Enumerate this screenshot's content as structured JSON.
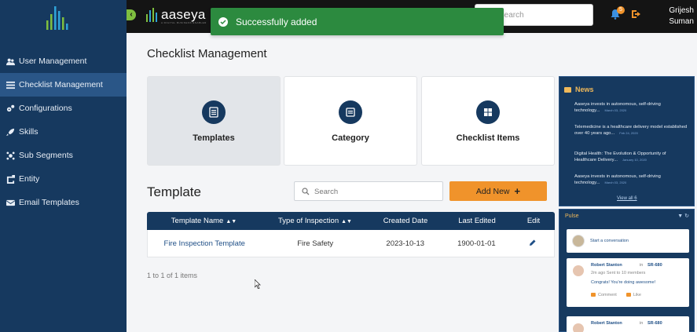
{
  "sidebar": {
    "items": [
      {
        "label": "User Management",
        "icon": "users-icon"
      },
      {
        "label": "Checklist Management",
        "icon": "list-icon",
        "active": true
      },
      {
        "label": "Configurations",
        "icon": "gears-icon"
      },
      {
        "label": "Skills",
        "icon": "rocket-icon"
      },
      {
        "label": "Sub Segments",
        "icon": "sitemap-icon"
      },
      {
        "label": "Entity",
        "icon": "entity-icon"
      },
      {
        "label": "Email Templates",
        "icon": "envelope-icon"
      }
    ]
  },
  "header": {
    "brand": "aaseya",
    "brand_tagline": "A DIGITAL BUSINESS ENABLER",
    "search_placeholder": "Search",
    "notification_count": "5",
    "user_first": "Grijesh",
    "user_last": "Suman"
  },
  "toast": {
    "message": "Successfully added"
  },
  "main": {
    "title": "Checklist Management",
    "cards": [
      {
        "label": "Templates",
        "selected": true
      },
      {
        "label": "Category"
      },
      {
        "label": "Checklist Items"
      }
    ],
    "section_title": "Template",
    "search_placeholder": "Search",
    "add_button": "Add New",
    "table": {
      "columns": [
        "Template Name",
        "Type of Inspection",
        "Created Date",
        "Last Edited",
        "Edit"
      ],
      "rows": [
        {
          "name": "Fire Inspection Template",
          "type": "Fire Safety",
          "created": "2023-10-13",
          "edited": "1900-01-01"
        }
      ]
    },
    "pager": "1 to 1 of 1 items"
  },
  "news": {
    "title": "News",
    "items": [
      {
        "text": "Aaseya invests in autonomous, self-driving technology...",
        "date": "March 03, 2020"
      },
      {
        "text": "Telemedicine is a healthcare delivery model established over 40 years ago...",
        "date": "Feb 24, 2020"
      },
      {
        "text": "Digital Health: The Evolution & Opportunity of Healthcare Delivery...",
        "date": "January 10, 2020"
      },
      {
        "text": "Aaseya invests in autonomous, self-driving technology...",
        "date": "March 03, 2020"
      }
    ],
    "view_all": "View all 6"
  },
  "pulse": {
    "title": "Pulse",
    "start_conversation": "Start a conversation",
    "posts": [
      {
        "author": "Robert Stanton",
        "in": "in",
        "ref": "SR-680",
        "meta": "2m ago  Sent to 10 members",
        "message": "Congrats! You're doing awesome!",
        "comment": "Comment",
        "like": "Like"
      },
      {
        "author": "Robert Stanton",
        "in": "in",
        "ref": "SR-680"
      }
    ]
  }
}
